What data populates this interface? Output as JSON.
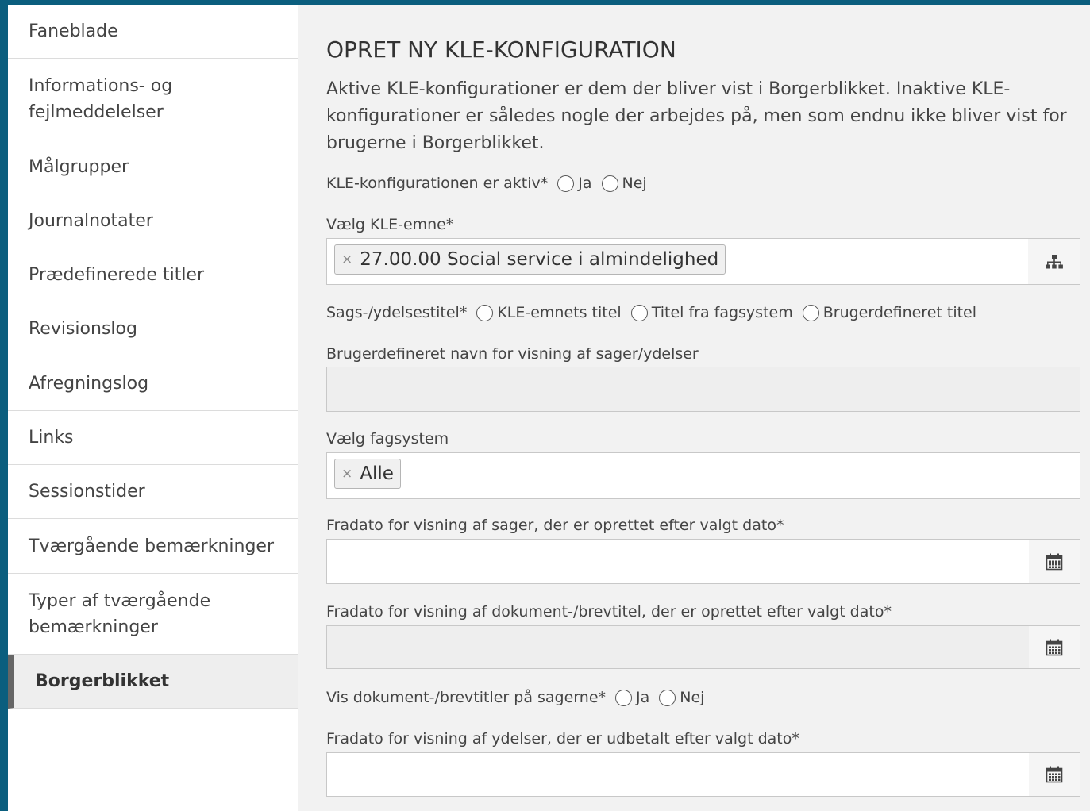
{
  "sidebar": {
    "items": [
      {
        "label": "Faneblade"
      },
      {
        "label": "Informations- og fejlmeddelelser"
      },
      {
        "label": "Målgrupper"
      },
      {
        "label": "Journalnotater"
      },
      {
        "label": "Prædefinerede titler"
      },
      {
        "label": "Revisionslog"
      },
      {
        "label": "Afregningslog"
      },
      {
        "label": "Links"
      },
      {
        "label": "Sessionstider"
      },
      {
        "label": "Tværgående bemærkninger"
      },
      {
        "label": "Typer af tværgående bemærkninger"
      },
      {
        "label": "Borgerblikket"
      }
    ],
    "active": "Borgerblikket"
  },
  "main": {
    "title": "OPRET NY KLE-KONFIGURATION",
    "intro": "Aktive KLE-konfigurationer er dem der bliver vist i Borgerblikket. Inaktive KLE-konfigurationer er således nogle der arbejdes på, men som endnu ikke bliver vist for brugerne i Borgerblikket.",
    "active_field": {
      "label": "KLE-konfigurationen er aktiv*",
      "options": [
        "Ja",
        "Nej"
      ]
    },
    "kle_subject": {
      "label": "Vælg KLE-emne*",
      "tag": "27.00.00 Social service i almindelighed",
      "remove_glyph": "×",
      "button_icon": "hierarchy-icon"
    },
    "case_title": {
      "label": "Sags-/ydelsestitel*",
      "options": [
        "KLE-emnets titel",
        "Titel fra fagsystem",
        "Brugerdefineret titel"
      ]
    },
    "custom_name": {
      "label": "Brugerdefineret navn for visning af sager/ydelser",
      "value": ""
    },
    "system": {
      "label": "Vælg fagsystem",
      "tag": "Alle",
      "remove_glyph": "×"
    },
    "from_date_cases": {
      "label": "Fradato for visning af sager, der er oprettet efter valgt dato*",
      "value": "",
      "button_icon": "calendar-icon"
    },
    "from_date_docs": {
      "label": "Fradato for visning af dokument-/brevtitel, der er oprettet efter valgt dato*",
      "value": "",
      "button_icon": "calendar-icon"
    },
    "show_doc_titles": {
      "label": "Vis dokument-/brevtitler på sagerne*",
      "options": [
        "Ja",
        "Nej"
      ]
    },
    "from_date_payments": {
      "label": "Fradato for visning af ydelser, der er udbetalt efter valgt dato*",
      "value": "",
      "button_icon": "calendar-icon"
    }
  }
}
